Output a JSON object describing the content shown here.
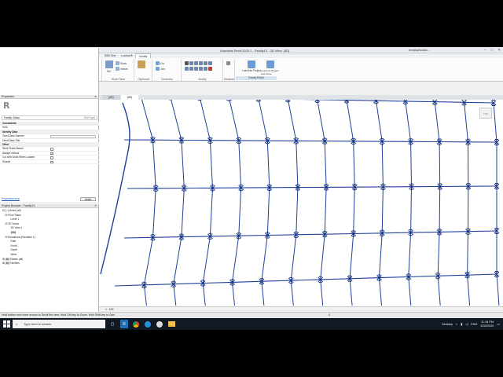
{
  "titlebar": {
    "title": "Autodesk Revit 2020.2 - Family13 - 3D View: {3D}",
    "user": "kim@aptsolarc..."
  },
  "ribbon": {
    "tabs": [
      "File",
      "Create",
      "Insert",
      "View",
      "Manage",
      "Add-Ins",
      "Quantification",
      "BIM One",
      "Lumion®",
      "Modify"
    ],
    "active_tab": "Modify",
    "groups": {
      "select": "Select ▾",
      "properties": "Properties",
      "draw": "Draw",
      "work_plane": "Work Plane",
      "clipboard": "Clipboard",
      "geometry": "Geometry",
      "modify": "Modify",
      "measure": "Measure",
      "create": "Create",
      "family_editor": "Family Editor"
    },
    "buttons": {
      "model": "Model",
      "reference": "Reference",
      "plane": "Plane",
      "set": "Set",
      "show": "Show",
      "viewer": "Viewer",
      "cut": "Cut",
      "join": "Join",
      "load_into_project": "Load into Project",
      "load_into_project_close": "Load into Project and Close"
    }
  },
  "properties": {
    "header": "Properties",
    "type_selector": "Family: Mass",
    "edit_type": "Edit Type",
    "rows": [
      {
        "label": "Constraints",
        "section": true
      },
      {
        "label": "Host",
        "section": false
      },
      {
        "label": "Identity Data",
        "section": true
      },
      {
        "label": "OmniClass Number",
        "section": false,
        "field": true
      },
      {
        "label": "OmniClass Title",
        "section": false
      },
      {
        "label": "Other",
        "section": true
      },
      {
        "label": "Work Plane-Based",
        "section": false,
        "checkbox": false
      },
      {
        "label": "Always vertical",
        "section": false,
        "checkbox": true
      },
      {
        "label": "Cut with Voids When Loaded",
        "section": false,
        "checkbox": false
      },
      {
        "label": "Shared",
        "section": false,
        "checkbox": false
      }
    ],
    "help_link": "Properties help",
    "apply": "Apply"
  },
  "browser": {
    "header": "Project Browser - Family13",
    "nodes": [
      {
        "label": "⊟ [○] Views (all)",
        "indent": 0
      },
      {
        "label": "⊟ Floor Plans",
        "indent": 1
      },
      {
        "label": "Level 1",
        "indent": 3
      },
      {
        "label": "⊟ 3D Views",
        "indent": 1
      },
      {
        "label": "3D View 1",
        "indent": 3
      },
      {
        "label": "{3D}",
        "indent": 3,
        "bold": true
      },
      {
        "label": "⊟ Elevations (Elevation 1)",
        "indent": 1
      },
      {
        "label": "East",
        "indent": 3
      },
      {
        "label": "North",
        "indent": 3
      },
      {
        "label": "South",
        "indent": 3
      },
      {
        "label": "West",
        "indent": 3
      },
      {
        "label": "⊞ [▤] Sheets (all)",
        "indent": 0
      },
      {
        "label": "⊞ [▤] Families",
        "indent": 0
      }
    ]
  },
  "view": {
    "tabs": [
      "{3D}",
      "{3D}"
    ],
    "scale": "1 : 100",
    "navcube": "TOP"
  },
  "status": {
    "text": "Hold button and move mouse to Scroll the view. Hold Ctrl key to Zoom. Hold Shift key to Spin.",
    "right": "0"
  },
  "taskbar": {
    "search_placeholder": "Type here to search",
    "desktop": "Desktop",
    "lang": "ENG",
    "time": "11:18 PM",
    "date": "8/30/2020"
  }
}
